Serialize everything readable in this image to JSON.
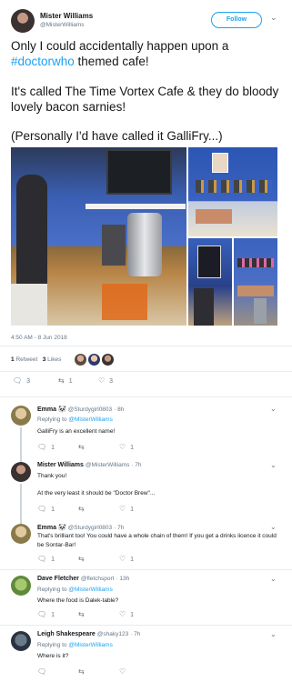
{
  "tweet": {
    "author_name": "Mister Williams",
    "author_handle": "@MisterWilliams",
    "follow_label": "Follow",
    "text_line1": "Only I could accidentally happen upon a",
    "hashtag": "#doctorwho",
    "text_line2_rest": " themed cafe!",
    "text_para2": "It's called The Time Vortex Cafe & they do bloody lovely bacon sarnies!",
    "text_para3": "(Personally I'd have called it GalliFry...)",
    "timestamp": "4:50 AM - 8 Jun 2018",
    "retweets_count": "1",
    "retweets_label": "Retweet",
    "likes_count": "3",
    "likes_label": "Likes",
    "reply_count": "3",
    "retweet_action_count": "1",
    "like_action_count": "3"
  },
  "replies": [
    {
      "name": "Emma",
      "emoji": "🐼",
      "handle": "@Sturdygirl0803",
      "time": "· 8h",
      "replying_prefix": "Replying to",
      "replying_to": "@MisterWilliams",
      "text": "GalliFry is an excellent name!",
      "reply_count": "1",
      "retweet_count": "",
      "like_count": "1"
    },
    {
      "name": "Mister Williams",
      "emoji": "",
      "handle": "@MisterWilliams",
      "time": "· 7h",
      "replying_prefix": "",
      "replying_to": "",
      "text": "Thank you!",
      "text2": "At the very least it should be \"Doctor Brew\"...",
      "reply_count": "1",
      "retweet_count": "",
      "like_count": "1"
    },
    {
      "name": "Emma",
      "emoji": "🐼",
      "handle": "@Sturdygirl0803",
      "time": "· 7h",
      "replying_prefix": "",
      "replying_to": "",
      "text": "That's brilliant too! You could have a whole chain of them! If you get a drinks licence it could be Sontar-Bar!",
      "reply_count": "1",
      "retweet_count": "",
      "like_count": "1"
    },
    {
      "name": "Dave Fletcher",
      "emoji": "",
      "handle": "@fletchsport",
      "time": "· 13h",
      "replying_prefix": "Replying to",
      "replying_to": "@MisterWilliams",
      "text": "Where the food is Dalek-table?",
      "reply_count": "1",
      "retweet_count": "",
      "like_count": "1"
    },
    {
      "name": "Leigh Shakespeare",
      "emoji": "",
      "handle": "@shaky123",
      "time": "· 7h",
      "replying_prefix": "Replying to",
      "replying_to": "@MisterWilliams",
      "text": "Where is it?",
      "reply_count": "",
      "retweet_count": "",
      "like_count": ""
    }
  ],
  "icons": {
    "reply": "reply-icon",
    "retweet": "retweet-icon",
    "like": "heart-icon",
    "more": "chevron-down-icon"
  },
  "colors": {
    "accent": "#1da1f2",
    "secondary_text": "#657786",
    "divider": "#e6ecf0"
  }
}
